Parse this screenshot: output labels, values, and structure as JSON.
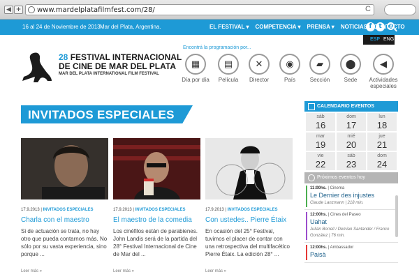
{
  "browser": {
    "url": "www.mardelplatafilmfest.com/28/",
    "back_label": "◀",
    "add_label": "+",
    "reload_label": "C"
  },
  "topbar": {
    "dates": "16 al 24 de Noviembre de 2013",
    "place": "Mar del Plata, Argentina.",
    "nav": [
      "EL FESTIVAL ▾",
      "COMPETENCIA ▾",
      "PRENSA ▾",
      "NOTICIAS",
      "CONTACTO"
    ],
    "facebook": "f",
    "twitter": "t"
  },
  "lang": {
    "esp": "ESP",
    "eng": "ENG"
  },
  "festival": {
    "number": "28",
    "line1": "FESTIVAL INTERNACIONAL",
    "line2": "DE CINE DE MAR DEL PLATA",
    "line3": "MAR DEL PLATA INTERNATIONAL FILM FESTIVAL"
  },
  "programacion": {
    "prompt": "Encontrá la programación por...",
    "filters": [
      {
        "label": "Día por día",
        "icon": "calendar-icon",
        "glyph": "▦"
      },
      {
        "label": "Película",
        "icon": "film-icon",
        "glyph": "▤"
      },
      {
        "label": "Director",
        "icon": "director-chair-icon",
        "glyph": "✕"
      },
      {
        "label": "País",
        "icon": "globe-icon",
        "glyph": "◉"
      },
      {
        "label": "Sección",
        "icon": "clapperboard-icon",
        "glyph": "▰"
      },
      {
        "label": "Sede",
        "icon": "map-pin-icon",
        "glyph": "⬤"
      },
      {
        "label": "Actividades especiales",
        "icon": "megaphone-icon",
        "glyph": "◀"
      }
    ]
  },
  "section_title": "INVITADOS ESPECIALES",
  "cards": [
    {
      "date": "17.9.2013",
      "category": "INVITADOS ESPECIALES",
      "title": "Charla con el maestro",
      "desc": "Si de actuación se trata, no hay otro que pueda contarnos más. No sólo por su vasta experiencia, sino porque ...",
      "more": "Leer más »"
    },
    {
      "date": "17.9.2013",
      "category": "INVITADOS ESPECIALES",
      "title": "El maestro de la comedia",
      "desc": "Los cinéfilos están de parabienes. John Landis será de la partida del 28° Festival Internacional de Cine de Mar del ...",
      "more": "Leer más »"
    },
    {
      "date": "17.9.2013",
      "category": "INVITADOS ESPECIALES",
      "title": "Con ustedes.. Pierre Étaix",
      "desc": "En ocasión del 25° Festival, tuvimos el placer de contar con una retrospectiva del multifacético Pierre Étaix. La edición 28° ...",
      "more": "Leer más »"
    }
  ],
  "calendar": {
    "title": "CALENDARIO EVENTOS",
    "days": [
      {
        "dow": "sáb",
        "num": "16"
      },
      {
        "dow": "dom",
        "num": "17"
      },
      {
        "dow": "lun",
        "num": "18"
      },
      {
        "dow": "mar",
        "num": "19"
      },
      {
        "dow": "mié",
        "num": "20"
      },
      {
        "dow": "jue",
        "num": "21"
      },
      {
        "dow": "vie",
        "num": "22"
      },
      {
        "dow": "sáb",
        "num": "23"
      },
      {
        "dow": "dom",
        "num": "24"
      }
    ]
  },
  "next_events": {
    "title": "Próximos eventos hoy",
    "events": [
      {
        "time": "11:00hs.",
        "place": "Cinema",
        "name": "Le Dernier des injustes",
        "people": "Claude Lanzmann",
        "duration": "218 min.",
        "color": "#4caf50"
      },
      {
        "time": "12:00hs.",
        "place": "Cines del Paseo",
        "name": "Uahat",
        "people": "Julián Borrell / Demian Santander / Franco González",
        "duration": "76 min.",
        "color": "#9c4dcc"
      },
      {
        "time": "12:00hs.",
        "place": "Ambassador",
        "name": "Paisà",
        "people": "",
        "duration": "",
        "color": "#e53935"
      }
    ]
  }
}
